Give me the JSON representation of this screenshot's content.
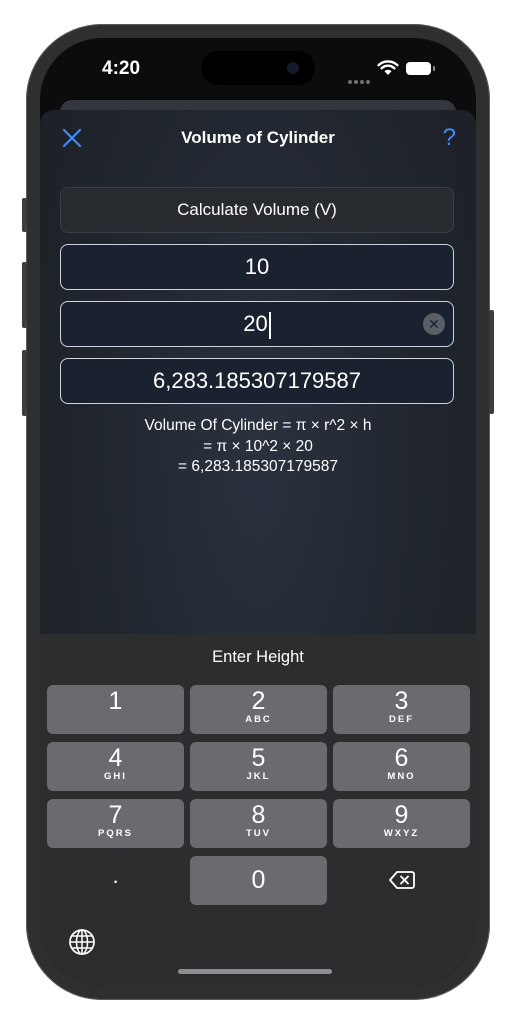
{
  "status_bar": {
    "time": "4:20"
  },
  "nav": {
    "title": "Volume of Cylinder",
    "close_icon": "close-icon",
    "help_label": "?"
  },
  "form": {
    "calculate_select": "Calculate Volume (V)",
    "radius_value": "10",
    "height_value": "20",
    "result_value": "6,283.185307179587"
  },
  "formula": {
    "line1": "Volume Of Cylinder = π × r^2 × h",
    "line2": "= π × 10^2 × 20",
    "line3": "= 6,283.185307179587"
  },
  "keyboard": {
    "header": "Enter Height",
    "keys": [
      {
        "digit": "1",
        "letters": ""
      },
      {
        "digit": "2",
        "letters": "ABC"
      },
      {
        "digit": "3",
        "letters": "DEF"
      },
      {
        "digit": "4",
        "letters": "GHI"
      },
      {
        "digit": "5",
        "letters": "JKL"
      },
      {
        "digit": "6",
        "letters": "MNO"
      },
      {
        "digit": "7",
        "letters": "PQRS"
      },
      {
        "digit": "8",
        "letters": "TUV"
      },
      {
        "digit": "9",
        "letters": "WXYZ"
      }
    ],
    "dot": ".",
    "zero": "0",
    "delete_icon": "delete-backspace-icon",
    "globe_icon": "globe-icon"
  },
  "colors": {
    "accent": "#3a8cff",
    "key_background": "#6a6b6f",
    "keyboard_background": "#2c2d2f"
  }
}
